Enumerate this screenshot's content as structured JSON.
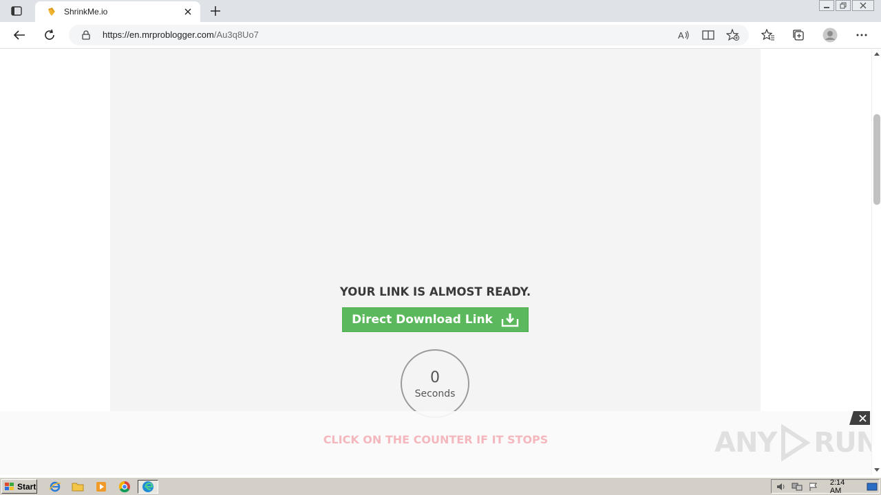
{
  "browser": {
    "tab_title": "ShrinkMe.io",
    "url_host": "https://en.mrproblogger.com",
    "url_path": "/Au3q8Uo7"
  },
  "page": {
    "heading": "YOUR LINK IS ALMOST READY.",
    "download_button_label": "Direct Download Link",
    "counter_value": "0",
    "counter_label": "Seconds",
    "click_hint": "CLICK ON THE COUNTER IF IT STOPS"
  },
  "watermark": {
    "text_left": "ANY",
    "text_right": "RUN"
  },
  "taskbar": {
    "start_label": "Start",
    "clock": "2:14 AM"
  },
  "colors": {
    "download_button": "#5cb85c",
    "click_hint": "#f4b7bd",
    "content_bg": "#f4f4f4"
  }
}
